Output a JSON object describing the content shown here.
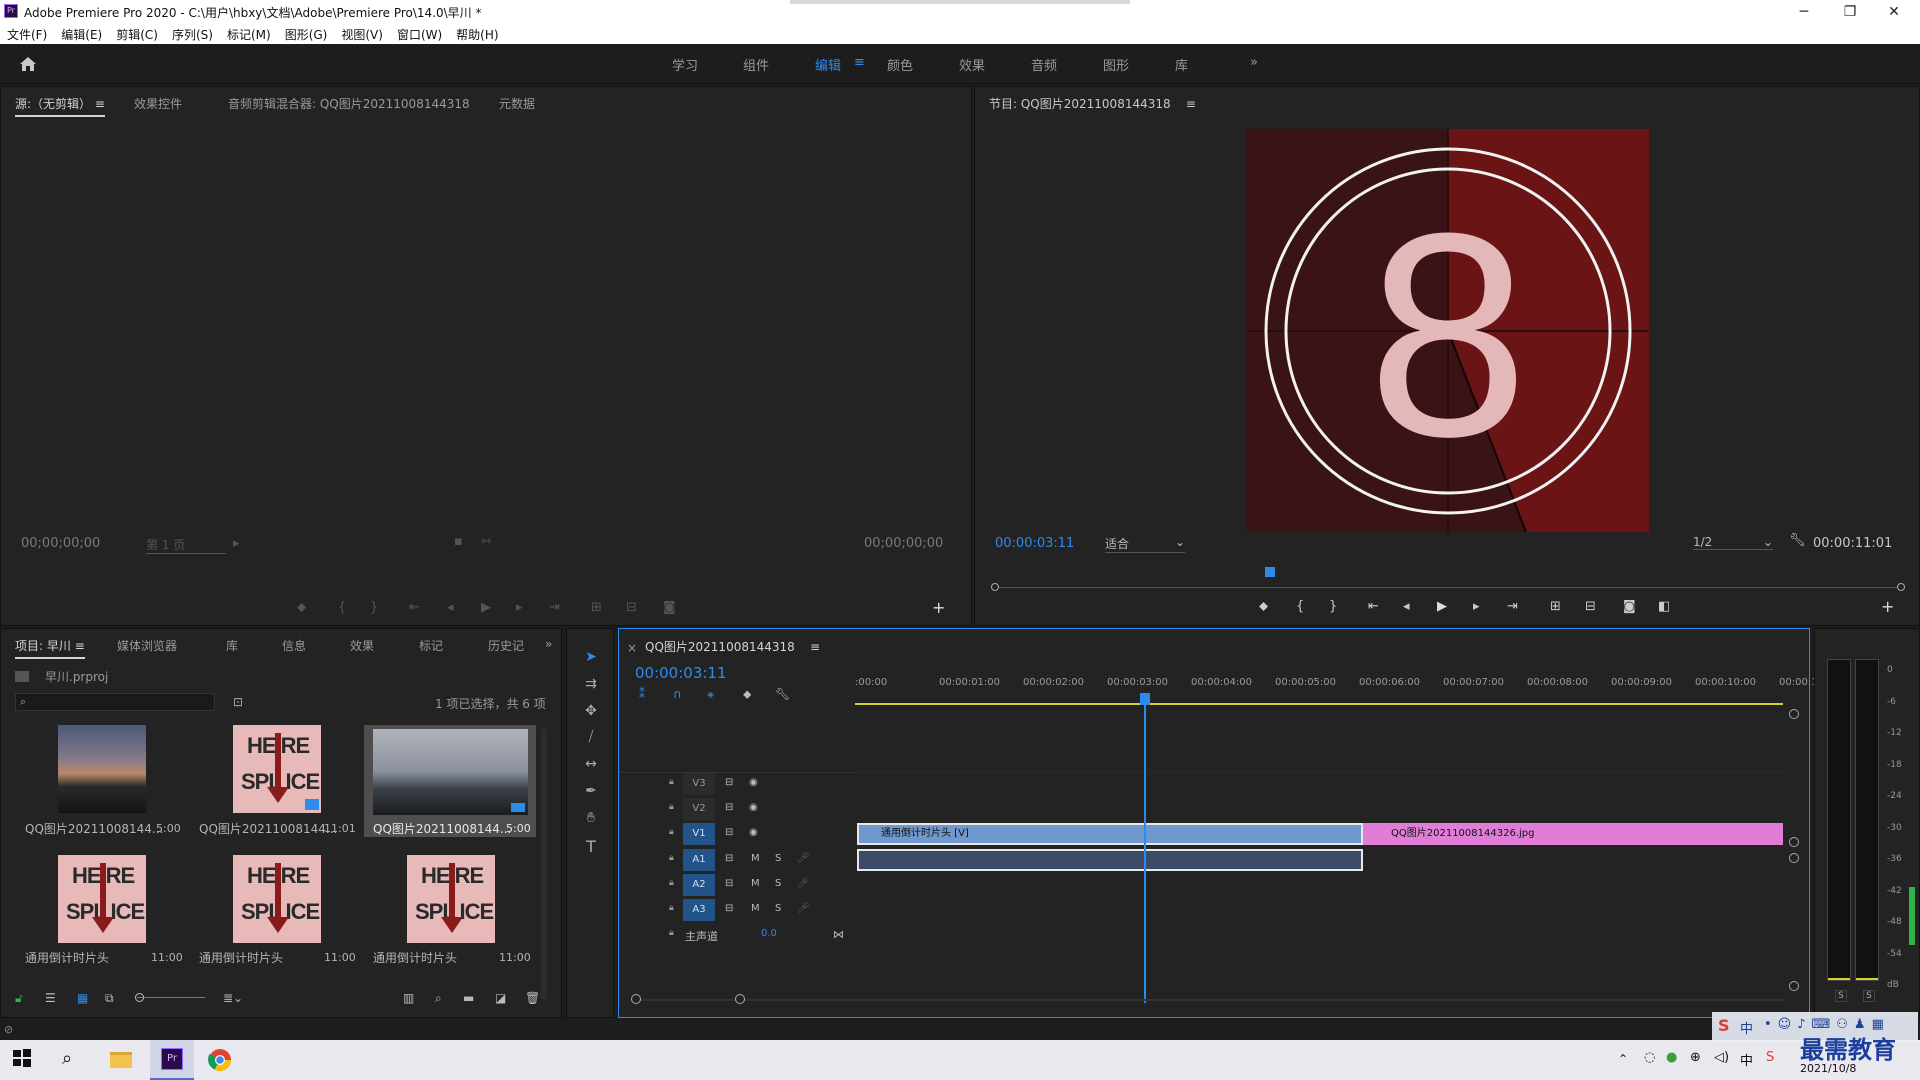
{
  "window": {
    "title": "Adobe Premiere Pro 2020 - C:\\用户\\hbxy\\文档\\Adobe\\Premiere Pro\\14.0\\早川 *",
    "app_badge": "Pr",
    "minimize": "─",
    "restore": "❐",
    "close": "✕"
  },
  "menu": [
    "文件(F)",
    "编辑(E)",
    "剪辑(C)",
    "序列(S)",
    "标记(M)",
    "图形(G)",
    "视图(V)",
    "窗口(W)",
    "帮助(H)"
  ],
  "workspaces": {
    "items": [
      "学习",
      "组件",
      "编辑",
      "颜色",
      "效果",
      "音频",
      "图形",
      "库"
    ],
    "active_index": 2,
    "more": "»",
    "menu_glyph": "≡"
  },
  "source_panel": {
    "tabs": [
      "源:（无剪辑）",
      "效果控件",
      "音频剪辑混合器: QQ图片20211008144318",
      "元数据"
    ],
    "menu_glyph": "≡",
    "timecode_left": "00;00;00;00",
    "page_dropdown": "第 1 页",
    "timecode_right": "00;00;00;00"
  },
  "program_panel": {
    "title": "节目: QQ图片20211008144318",
    "menu_glyph": "≡",
    "timecode": "00:00:03:11",
    "fit": "适合",
    "resolution": "1/2",
    "duration": "00:00:11:01",
    "countdown_number": "8",
    "playhead_fraction": 0.3
  },
  "project_panel": {
    "tabs": [
      "项目: 早川",
      "媒体浏览器",
      "库",
      "信息",
      "效果",
      "标记",
      "历史记"
    ],
    "menu_glyph": "≡",
    "more": "»",
    "project_file": "早川.prproj",
    "search_placeholder": "",
    "selection_info": "1 项已选择，共 6 项",
    "items": [
      {
        "label": "QQ图片20211008144...",
        "duration": "5:00",
        "kind": "photo1"
      },
      {
        "label": "QQ图片20211008144...",
        "duration": "11:01",
        "kind": "splice"
      },
      {
        "label": "QQ图片20211008144...",
        "duration": "5:00",
        "kind": "photo3",
        "selected": true
      },
      {
        "label": "通用倒计时片头",
        "duration": "11:00",
        "kind": "splice"
      },
      {
        "label": "通用倒计时片头",
        "duration": "11:00",
        "kind": "splice"
      },
      {
        "label": "通用倒计时片头",
        "duration": "11:00",
        "kind": "splice"
      }
    ],
    "thumb_text_top": "HE RE",
    "thumb_text_bottom": "SPL ICE"
  },
  "timeline": {
    "sequence_tab": "QQ图片20211008144318",
    "close_glyph": "×",
    "menu_glyph": "≡",
    "timecode": "00:00:03:11",
    "ruler_labels": [
      ":00:00",
      "00:00:01:00",
      "00:00:02:00",
      "00:00:03:00",
      "00:00:04:00",
      "00:00:05:00",
      "00:00:06:00",
      "00:00:07:00",
      "00:00:08:00",
      "00:00:09:00",
      "00:00:10:00",
      "00:00:1"
    ],
    "video_tracks": [
      "V3",
      "V2",
      "V1"
    ],
    "audio_tracks": [
      "A1",
      "A2",
      "A3"
    ],
    "mute": "M",
    "solo": "S",
    "master_label": "主声道",
    "master_value": "0.0",
    "clips": {
      "v1_countdown": "通用倒计时片头 [V]",
      "v1_image": "QQ图片20211008144326.jpg"
    }
  },
  "audio_meter": {
    "scale": [
      "0",
      "-6",
      "-12",
      "-18",
      "-24",
      "-30",
      "-36",
      "-42",
      "-48",
      "-54",
      "dB"
    ],
    "solo_buttons": [
      "S",
      "S"
    ]
  },
  "taskbar": {
    "date": "2021/10/8",
    "ime": "中",
    "watermark": "最需教育"
  },
  "colors": {
    "accent_blue": "#2d8ceb",
    "clip_blue": "#6f98cf",
    "clip_pink": "#e07ed7",
    "countdown_dark": "#3a1317",
    "countdown_red": "#6a1416",
    "playhead": "#2d8ceb",
    "work_area": "#d6d02a"
  }
}
